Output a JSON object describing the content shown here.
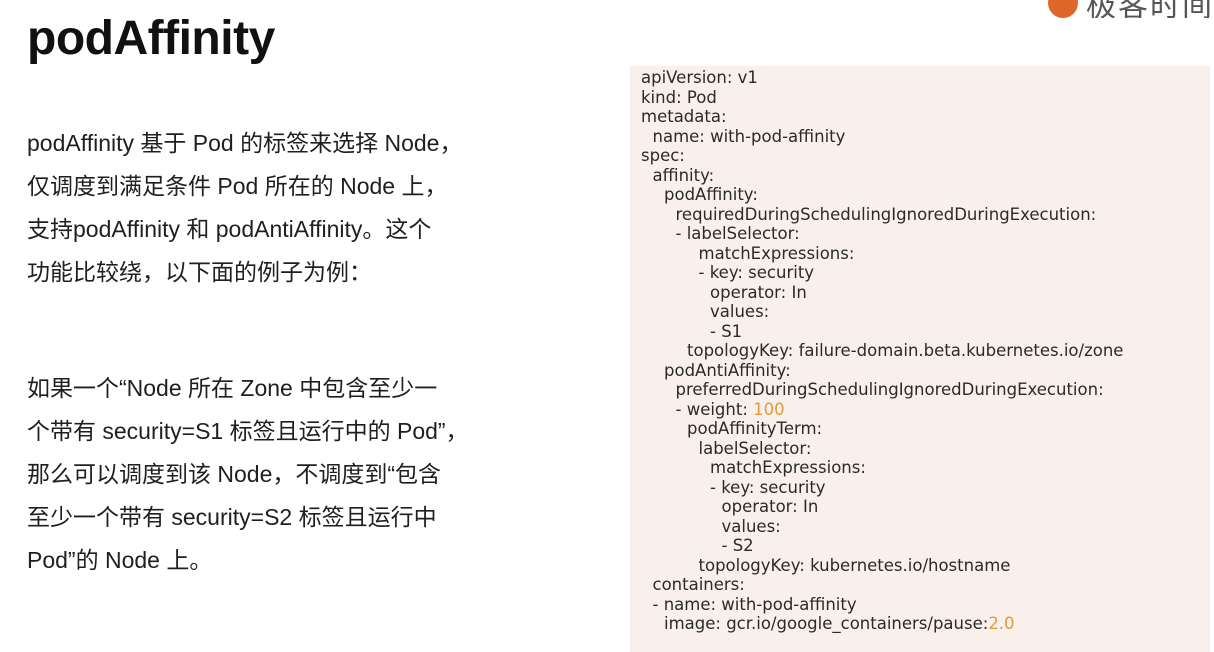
{
  "slide": {
    "title": "podAffinity",
    "logo_text": "极客时间"
  },
  "description": {
    "para1": [
      "podAffinity 基于 Pod 的标签来选择 Node，",
      "仅调度到满足条件 Pod 所在的 Node  上，",
      "支持podAffinity 和 podAntiAffinity。这个",
      "功能比较绕，以下面的例子为例："
    ],
    "para2": [
      "如果一个“Node 所在 Zone 中包含至少一",
      "个带有 security=S1 标签且运行中的 Pod”，",
      "那么可以调度到该 Node，不调度到“包含",
      "至少一个带有 security=S2 标签且运行中",
      "Pod”的 Node 上。"
    ]
  },
  "code": {
    "lines": [
      {
        "indent": 0,
        "text": "apiVersion: v1"
      },
      {
        "indent": 0,
        "text": "kind: Pod"
      },
      {
        "indent": 0,
        "text": "metadata:"
      },
      {
        "indent": 1,
        "text": "name: with-pod-affinity"
      },
      {
        "indent": 0,
        "text": "spec:"
      },
      {
        "indent": 1,
        "text": "affinity:"
      },
      {
        "indent": 2,
        "text": "podAffinity:"
      },
      {
        "indent": 3,
        "text": "requiredDuringSchedulingIgnoredDuringExecution:"
      },
      {
        "indent": 3,
        "text": "- labelSelector:"
      },
      {
        "indent": 5,
        "text": "matchExpressions:"
      },
      {
        "indent": 5,
        "text": "- key: security"
      },
      {
        "indent": 6,
        "text": "operator: In"
      },
      {
        "indent": 6,
        "text": "values:"
      },
      {
        "indent": 6,
        "text": "- S1"
      },
      {
        "indent": 4,
        "text": "topologyKey: failure-domain.beta.kubernetes.io/zone"
      },
      {
        "indent": 2,
        "text": "podAntiAffinity:"
      },
      {
        "indent": 3,
        "text": "preferredDuringSchedulingIgnoredDuringExecution:"
      },
      {
        "indent": 3,
        "text": "- weight: ",
        "value": "100"
      },
      {
        "indent": 4,
        "text": "podAffinityTerm:"
      },
      {
        "indent": 5,
        "text": "labelSelector:"
      },
      {
        "indent": 6,
        "text": "matchExpressions:"
      },
      {
        "indent": 6,
        "text": "- key: security"
      },
      {
        "indent": 7,
        "text": "operator: In"
      },
      {
        "indent": 7,
        "text": "values:"
      },
      {
        "indent": 7,
        "text": "- S2"
      },
      {
        "indent": 5,
        "text": "topologyKey: kubernetes.io/hostname"
      },
      {
        "indent": 1,
        "text": "containers:"
      },
      {
        "indent": 1,
        "text": "- name: with-pod-affinity"
      },
      {
        "indent": 2,
        "text": "image: gcr.io/google_containers/pause:",
        "value": "2.0"
      }
    ],
    "number_color": "#e39a3a",
    "panel_background": "#f9f0ec"
  }
}
